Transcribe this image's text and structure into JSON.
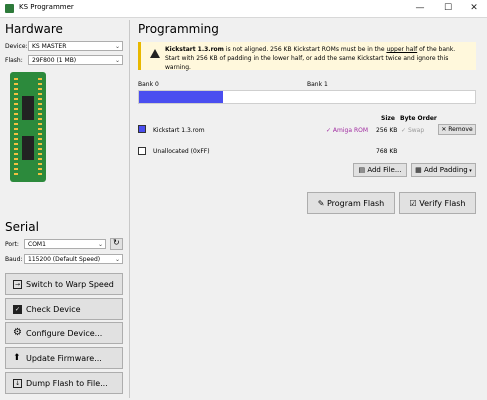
{
  "window": {
    "title": "KS Programmer",
    "controls": [
      "—",
      "☐",
      "✕"
    ]
  },
  "hardware": {
    "heading": "Hardware",
    "device_label": "Device:",
    "device_value": "KS MASTER",
    "flash_label": "Flash:",
    "flash_value": "29F800 (1 MB)"
  },
  "serial": {
    "heading": "Serial",
    "port_label": "Port:",
    "port_value": "COM1",
    "baud_label": "Baud:",
    "baud_value": "115200 (Default Speed)"
  },
  "actions": [
    {
      "label": "Switch to Warp Speed",
      "icon": "arrow-right-box-icon"
    },
    {
      "label": "Check Device",
      "icon": "checkbox-icon"
    },
    {
      "label": "Configure Device...",
      "icon": "gear-icon"
    },
    {
      "label": "Update Firmware...",
      "icon": "upload-arrow-icon"
    },
    {
      "label": "Dump Flash to File...",
      "icon": "save-arrow-icon"
    }
  ],
  "programming": {
    "heading": "Programming",
    "warning": {
      "filename": "Kickstart 1.3.rom",
      "text1": " is not aligned. 256 KB Kickstart ROMs must be in the ",
      "link": "upper half",
      "text2": " of the bank.",
      "line2": "Start with 256 KB of padding in the lower half, or add the same Kickstart twice and ignore this warning."
    },
    "bank0_label": "Bank 0",
    "bank1_label": "Bank 1",
    "bank_fill_fraction": 0.25,
    "col_size": "Size",
    "col_byte_order": "Byte Order",
    "rows": [
      {
        "name": "Kickstart 1.3.rom",
        "check": "✓ Amiga ROM",
        "size": "256 KB",
        "swap": "Swap",
        "remove": "Remove",
        "color": "#4a4ef0"
      }
    ],
    "unallocated": {
      "name": "Unallocated (0xFF)",
      "size": "768 KB"
    },
    "add_file": "Add File...",
    "add_padding": "Add Padding",
    "program_flash": "Program Flash",
    "verify_flash": "Verify Flash"
  },
  "colors": {
    "accent": "#4a4ef0",
    "amiga": "#a02aa0",
    "warning": "#e8b800",
    "board": "#2c8a3c"
  }
}
